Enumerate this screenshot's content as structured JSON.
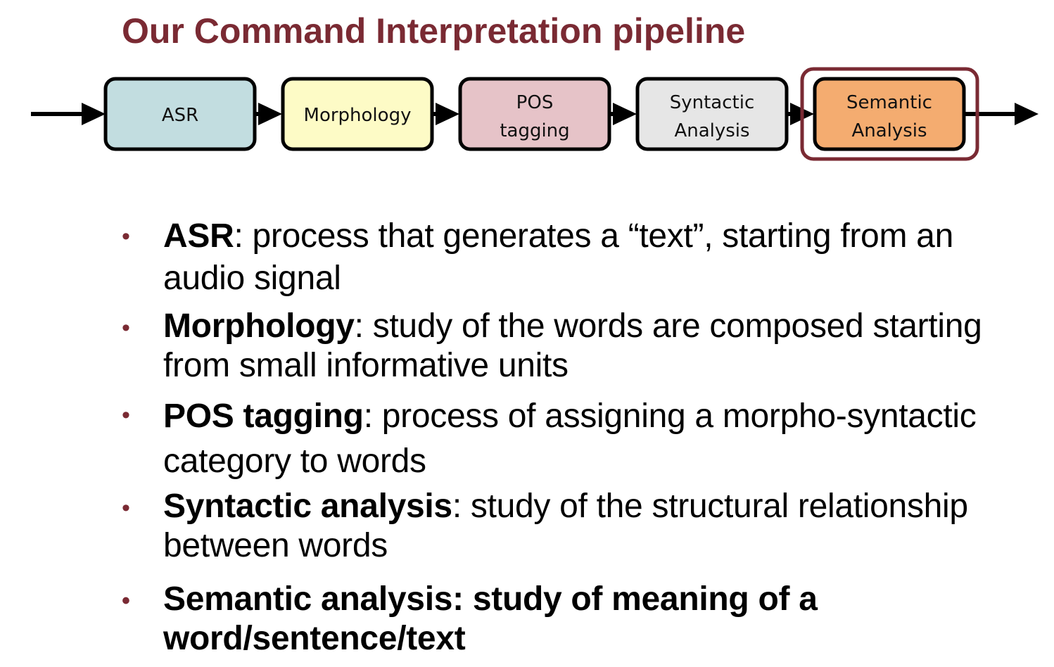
{
  "title": "Our Command Interpretation pipeline",
  "colors": {
    "title": "#7a2a33",
    "highlight_frame": "#7a2a33",
    "arrow": "#000000"
  },
  "pipeline": {
    "stages": [
      {
        "line1": "ASR",
        "line2": "",
        "fill": "#c2dde0"
      },
      {
        "line1": "Morphology",
        "line2": "",
        "fill": "#fdfbc6"
      },
      {
        "line1": "POS",
        "line2": "tagging",
        "fill": "#e6c3c8"
      },
      {
        "line1": "Syntactic",
        "line2": "Analysis",
        "fill": "#e6e6e6"
      },
      {
        "line1": "Semantic",
        "line2": "Analysis",
        "fill": "#f4ac70"
      }
    ],
    "highlighted_stage": 4
  },
  "bullets": [
    {
      "term": "ASR",
      "rest": ": process that generates a “text”, starting from an audio signal",
      "all_bold": false
    },
    {
      "term": "Morphology",
      "rest": ": study of the words are composed starting from small informative units",
      "all_bold": false
    },
    {
      "term": "POS tagging",
      "rest": ": process of assigning a morpho-syntactic category to words",
      "all_bold": false
    },
    {
      "term": "Syntactic analysis",
      "rest": ": study of the structural relationship between words",
      "all_bold": false
    },
    {
      "term": "Semantic analysis",
      "rest": ": study of meaning of a word/sentence/text",
      "all_bold": true
    }
  ]
}
